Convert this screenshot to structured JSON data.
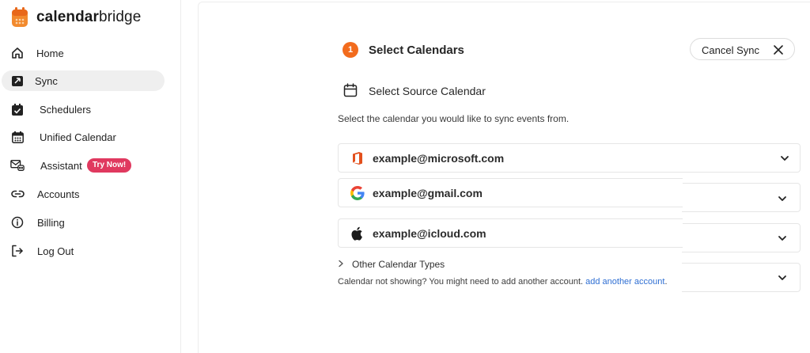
{
  "brand": {
    "name_bold": "calendar",
    "name_light": "bridge",
    "accent": "#f26b1d"
  },
  "sidebar": {
    "items": [
      {
        "label": "Home",
        "icon": "home-icon"
      },
      {
        "label": "Sync",
        "icon": "sync-calendar-icon",
        "active": true
      },
      {
        "label": "Schedulers",
        "icon": "scheduler-icon"
      },
      {
        "label": "Unified Calendar",
        "icon": "calendar-grid-icon"
      },
      {
        "label": "Assistant",
        "icon": "assistant-icon",
        "badge": "Try Now!"
      },
      {
        "label": "Accounts",
        "icon": "link-icon"
      },
      {
        "label": "Billing",
        "icon": "info-icon"
      },
      {
        "label": "Log Out",
        "icon": "logout-icon"
      }
    ]
  },
  "wizard": {
    "step_number": "1",
    "step_title": "Select Calendars",
    "cancel_label": "Cancel Sync",
    "section_title": "Select Source Calendar",
    "section_desc": "Select the calendar you would like to sync events from.",
    "accounts": [
      {
        "email": "example@microsoft.com",
        "provider": "microsoft-office-icon"
      },
      {
        "email": "example@gmail.com",
        "provider": "google-icon"
      },
      {
        "email": "example@icloud.com",
        "provider": "apple-icon"
      }
    ],
    "other_types": "Other Calendar Types",
    "help_text": "Calendar not showing? You might need to add another account.",
    "help_link": "add another account",
    "help_end": "."
  }
}
